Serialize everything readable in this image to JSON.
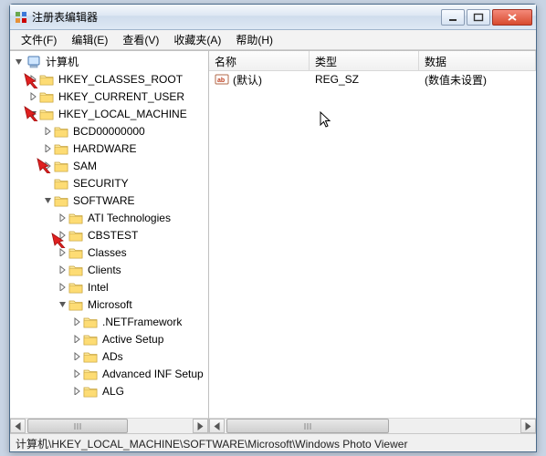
{
  "window": {
    "title": "注册表编辑器"
  },
  "menu": {
    "file": "文件(F)",
    "edit": "编辑(E)",
    "view": "查看(V)",
    "favorites": "收藏夹(A)",
    "help": "帮助(H)"
  },
  "tree": {
    "root": "计算机",
    "hives": {
      "hkcr": "HKEY_CLASSES_ROOT",
      "hkcu": "HKEY_CURRENT_USER",
      "hklm": "HKEY_LOCAL_MACHINE",
      "hklm_children": {
        "bcd": "BCD00000000",
        "hardware": "HARDWARE",
        "sam": "SAM",
        "security": "SECURITY",
        "software": "SOFTWARE",
        "software_children": {
          "ati": "ATI Technologies",
          "cbstest": "CBSTEST",
          "classes": "Classes",
          "clients": "Clients",
          "intel": "Intel",
          "microsoft": "Microsoft",
          "microsoft_children": {
            "netfx": ".NETFramework",
            "activesetup": "Active Setup",
            "ads": "ADs",
            "advinf": "Advanced INF Setup",
            "alg": "ALG"
          }
        }
      }
    }
  },
  "list": {
    "columns": {
      "name": "名称",
      "type": "类型",
      "data": "数据"
    },
    "rows": [
      {
        "name": "(默认)",
        "type": "REG_SZ",
        "data": "(数值未设置)"
      }
    ]
  },
  "status": "计算机\\HKEY_LOCAL_MACHINE\\SOFTWARE\\Microsoft\\Windows Photo Viewer"
}
